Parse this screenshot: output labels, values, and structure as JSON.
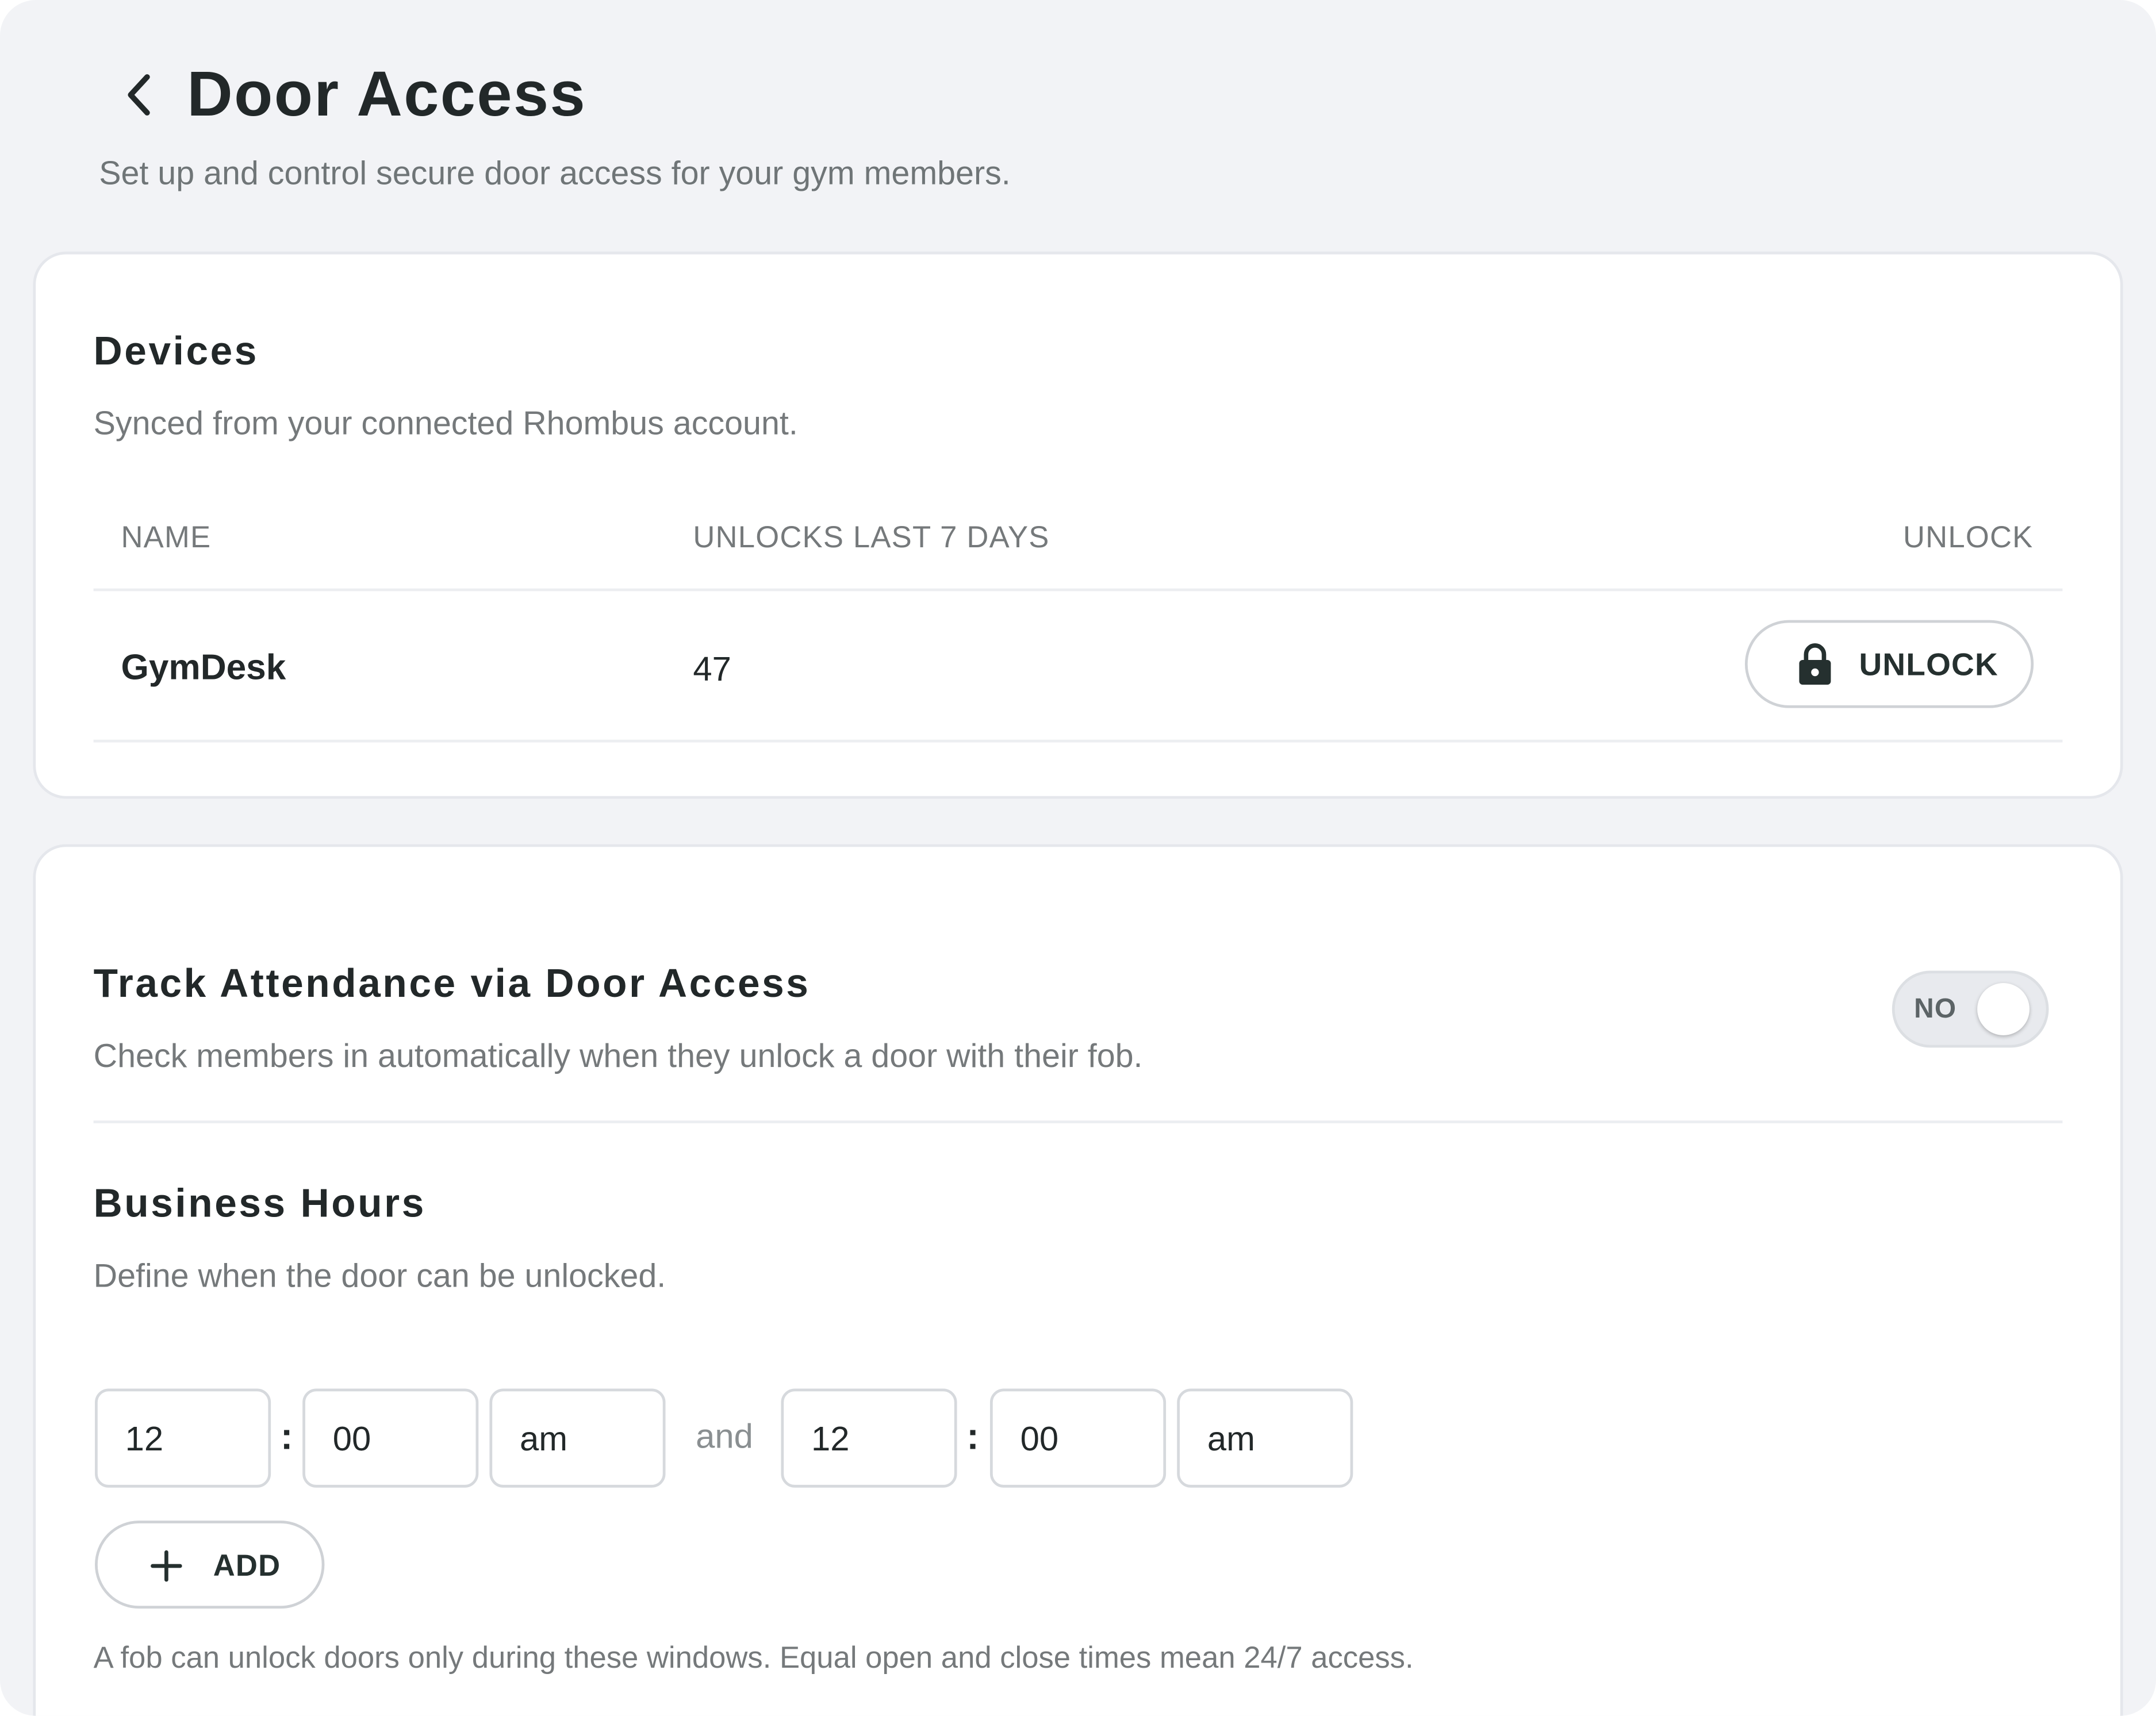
{
  "header": {
    "title": "Door Access",
    "subtitle": "Set up and control secure door access for your gym members."
  },
  "devices": {
    "title": "Devices",
    "description": "Synced from your connected Rhombus account.",
    "columns": [
      "NAME",
      "UNLOCKS LAST 7 DAYS",
      "UNLOCK"
    ],
    "rows": [
      {
        "name": "GymDesk",
        "unlocks_last_7_days": "47",
        "action_label": "UNLOCK"
      }
    ]
  },
  "attendance": {
    "title": "Track Attendance via Door Access",
    "description": "Check members in automatically when they unlock a door with their fob.",
    "toggle_label": "NO",
    "enabled": false
  },
  "business_hours": {
    "title": "Business Hours",
    "description": "Define when the door can be unlocked.",
    "window": {
      "open": {
        "hour": "12",
        "minute": "00",
        "period": "am"
      },
      "separator": ":",
      "joiner": "and",
      "close": {
        "hour": "12",
        "minute": "00",
        "period": "am"
      }
    },
    "add_label": "ADD",
    "footnote": "A fob can unlock doors only during these windows. Equal open and close times mean 24/7 access."
  },
  "icons": {
    "back": "chevron-left-icon",
    "lock": "lock-icon",
    "add": "plus-icon"
  },
  "colors": {
    "background": "#f2f3f6",
    "card": "#ffffff",
    "text": "#222829",
    "muted": "#75797b",
    "border": "#d6d9dd"
  }
}
